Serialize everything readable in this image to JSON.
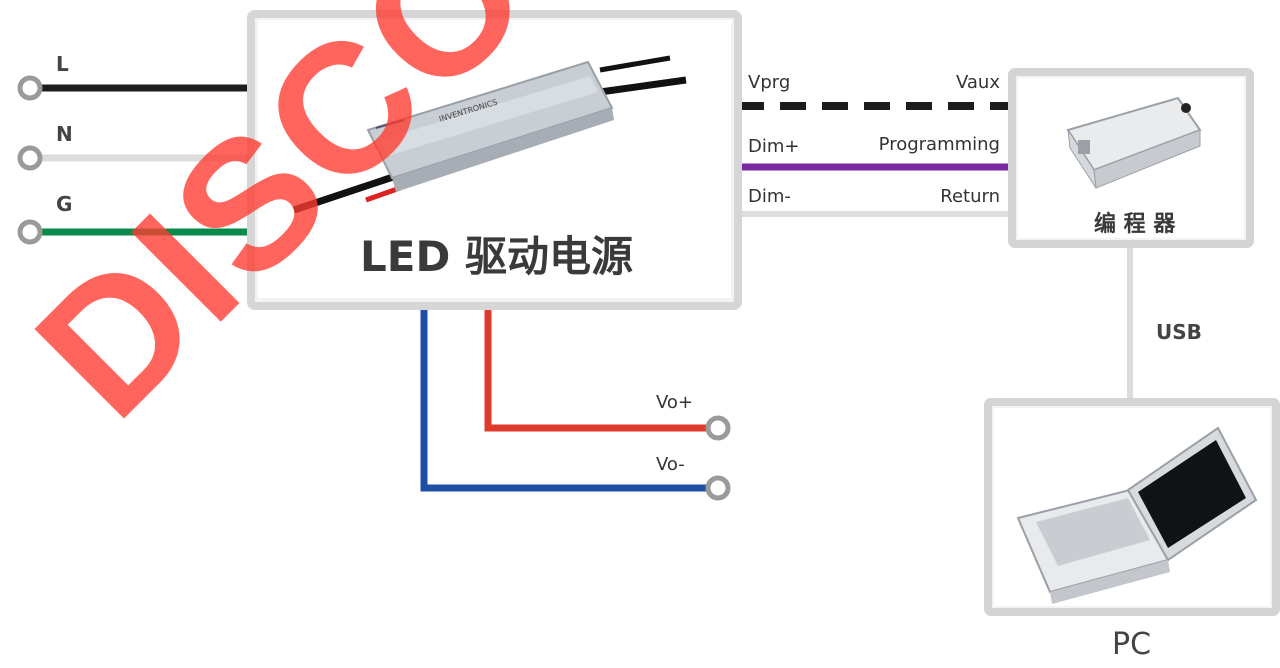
{
  "power_inputs": [
    {
      "label": "L",
      "color": "#1c1c1c"
    },
    {
      "label": "N",
      "color": "#e2e2e2"
    },
    {
      "label": "G",
      "color": "#0a8a4a"
    }
  ],
  "driver": {
    "title": "LED 驱动电源"
  },
  "signal_lines": [
    {
      "left": "Vprg",
      "right": "Vaux"
    },
    {
      "left": "Dim+",
      "right": "Programming"
    },
    {
      "left": "Dim-",
      "right": "Return"
    }
  ],
  "programmer": {
    "title": "编 程 器"
  },
  "link": {
    "label": "USB"
  },
  "pc": {
    "label": "PC"
  },
  "outputs": [
    {
      "label": "Vo+",
      "color": "#e03a2c"
    },
    {
      "label": "Vo-",
      "color": "#1f4fa5"
    }
  ],
  "watermark": {
    "text": "DISCON"
  },
  "colors": {
    "purple_line": "#7a2aa0",
    "box_border": "#d6d6d6"
  }
}
